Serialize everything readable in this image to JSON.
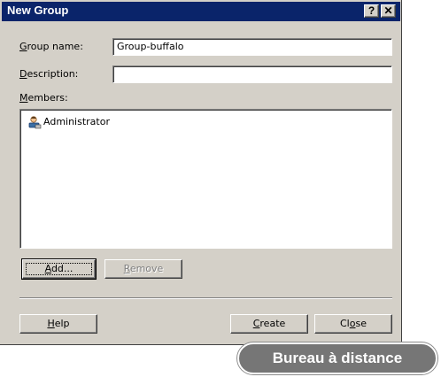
{
  "window": {
    "title": "New Group"
  },
  "titlebar": {
    "help_glyph": "?",
    "close_glyph": "✕"
  },
  "form": {
    "group_name": {
      "label_mnemonic": "G",
      "label_rest": "roup name:",
      "value": "Group-buffalo"
    },
    "description": {
      "label_mnemonic": "D",
      "label_rest": "escription:",
      "value": ""
    },
    "members": {
      "label_mnemonic": "M",
      "label_rest": "embers:",
      "items": [
        {
          "label": "Administrator",
          "icon": "user-icon"
        }
      ]
    }
  },
  "buttons": {
    "add": {
      "mnemonic": "A",
      "rest": "dd..."
    },
    "remove": {
      "mnemonic": "R",
      "rest": "emove"
    },
    "help": {
      "mnemonic": "H",
      "rest": "elp"
    },
    "create": {
      "mnemonic": "C",
      "rest": "reate"
    },
    "close": {
      "pre": "Cl",
      "mnemonic": "o",
      "rest": "se"
    }
  },
  "overlay": {
    "badge_text": "Bureau à distance"
  },
  "colors": {
    "titlebar": "#0a246a",
    "dialog": "#d4d0c8",
    "badge": "#767676"
  }
}
